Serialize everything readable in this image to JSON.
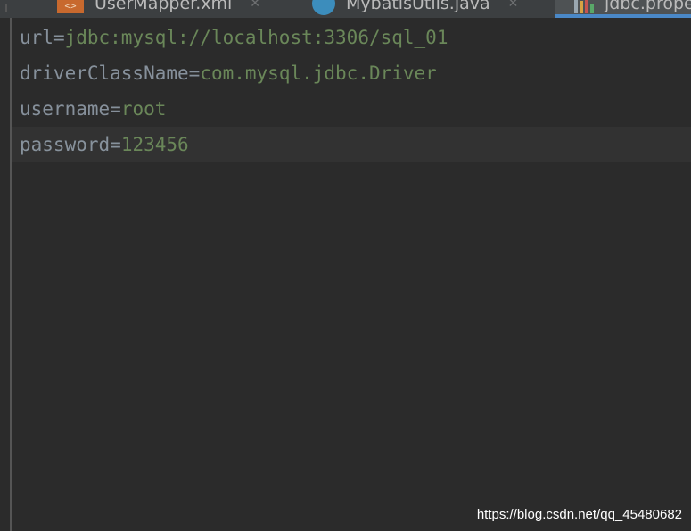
{
  "tabs": [
    {
      "label": "UserMapper.xml",
      "icon": "xml-file-icon",
      "icon_text": "<>",
      "active": false
    },
    {
      "label": "MybatisUtils.java",
      "icon": "java-class-icon",
      "active": false
    },
    {
      "label": "jdbc.properties",
      "icon": "properties-file-icon",
      "active": true
    }
  ],
  "editor": {
    "lines": [
      {
        "key": "url",
        "sep": "=",
        "value": "jdbc:mysql://localhost:3306/sql_01"
      },
      {
        "key": "driverClassName",
        "sep": "=",
        "value": "com.mysql.jdbc.Driver"
      },
      {
        "key": "username",
        "sep": "=",
        "value": "root"
      },
      {
        "key": "password",
        "sep": "=",
        "value": "123456"
      }
    ],
    "current_line_index": 3
  },
  "watermark": "https://blog.csdn.net/qq_45480682",
  "colors": {
    "editor_bg": "#2b2b2b",
    "key": "#a9b7c6",
    "value": "#6a8759",
    "active_tab_underline": "#4a88c7"
  }
}
